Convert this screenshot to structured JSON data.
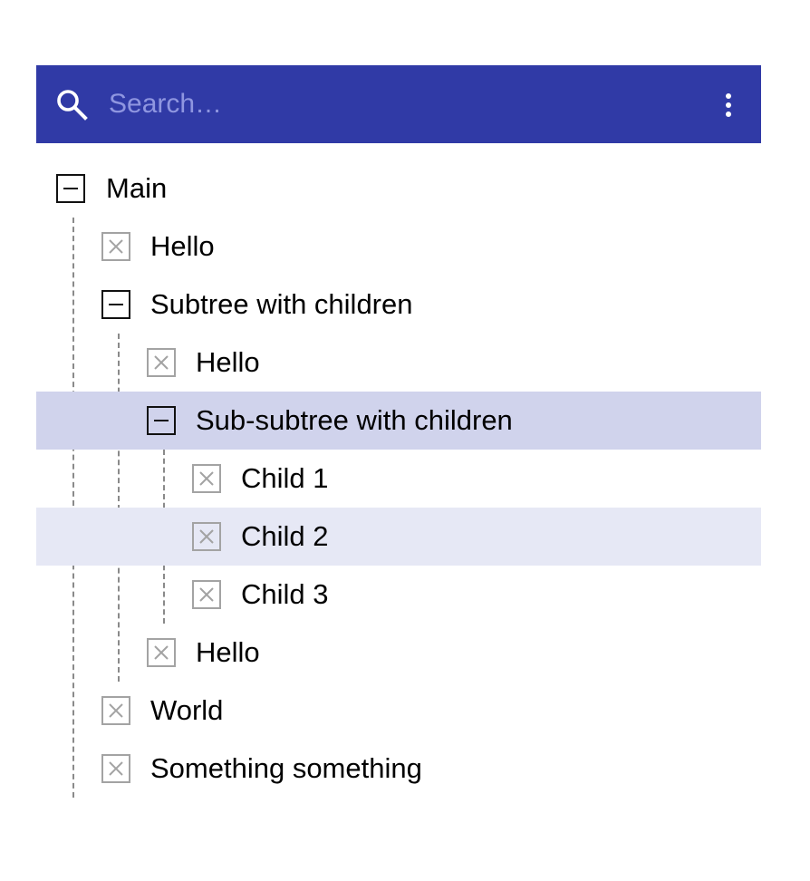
{
  "search": {
    "placeholder": "Search…",
    "value": ""
  },
  "icons": {
    "search": "search-icon",
    "more": "more-vertical-icon",
    "expanded": "collapse-minus-icon",
    "leaf": "leaf-x-icon"
  },
  "colors": {
    "header_bg": "#303aa6",
    "selected_row": "#d0d3ec",
    "hover_row": "#e6e8f5"
  },
  "tree": {
    "main": "Main",
    "hello_1": "Hello",
    "subtree": "Subtree with children",
    "hello_2": "Hello",
    "subsubtree": "Sub-subtree with children",
    "child_1": "Child 1",
    "child_2": "Child 2",
    "child_3": "Child 3",
    "hello_3": "Hello",
    "world": "World",
    "something": "Something something"
  }
}
